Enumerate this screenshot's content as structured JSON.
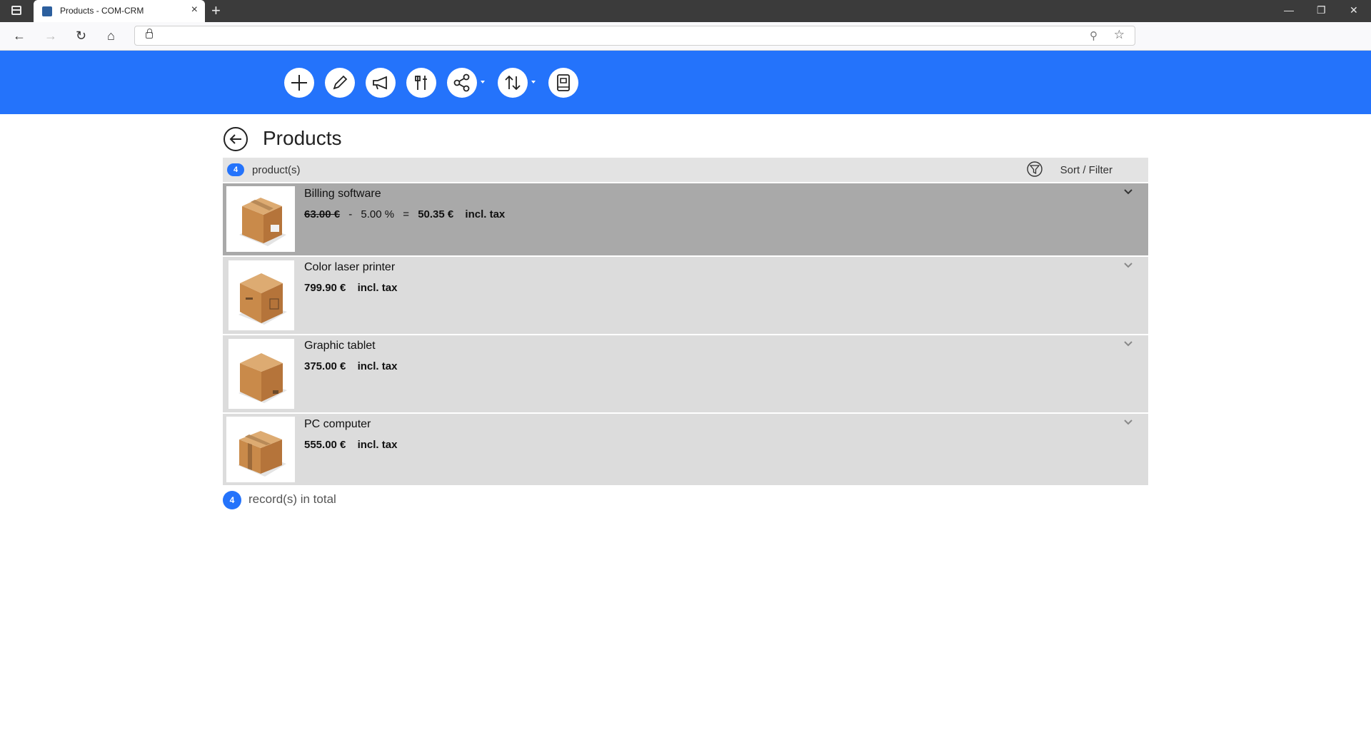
{
  "browser": {
    "tab_title": "Products - COM-CRM",
    "new_tab": "+",
    "tab_close": "×",
    "url": ""
  },
  "toolbar": {
    "buttons": [
      {
        "name": "add",
        "icon": "plus-icon"
      },
      {
        "name": "edit",
        "icon": "pencil-icon"
      },
      {
        "name": "campaign",
        "icon": "megaphone-icon"
      },
      {
        "name": "tools",
        "icon": "tools-icon"
      },
      {
        "name": "share",
        "icon": "share-icon",
        "dropdown": true
      },
      {
        "name": "sort",
        "icon": "sort-arrows-icon",
        "dropdown": true
      },
      {
        "name": "catalog",
        "icon": "book-icon"
      }
    ],
    "accent_color": "#2473fb"
  },
  "page": {
    "title": "Products"
  },
  "list": {
    "count": "4",
    "header_label": "product(s)",
    "sort_filter_label": "Sort / Filter",
    "items": [
      {
        "name": "Billing software",
        "old_price": "63.00 €",
        "discount_sep": "-",
        "discount": "5.00 %",
        "equals": "=",
        "price": "50.35 €",
        "tax_label": "incl. tax",
        "selected": true
      },
      {
        "name": "Color laser printer",
        "price": "799.90 €",
        "tax_label": "incl. tax",
        "selected": false
      },
      {
        "name": "Graphic tablet",
        "price": "375.00 €",
        "tax_label": "incl. tax",
        "selected": false
      },
      {
        "name": "PC computer",
        "price": "555.00 €",
        "tax_label": "incl. tax",
        "selected": false
      }
    ]
  },
  "footer": {
    "count": "4",
    "label": "record(s) in total"
  }
}
